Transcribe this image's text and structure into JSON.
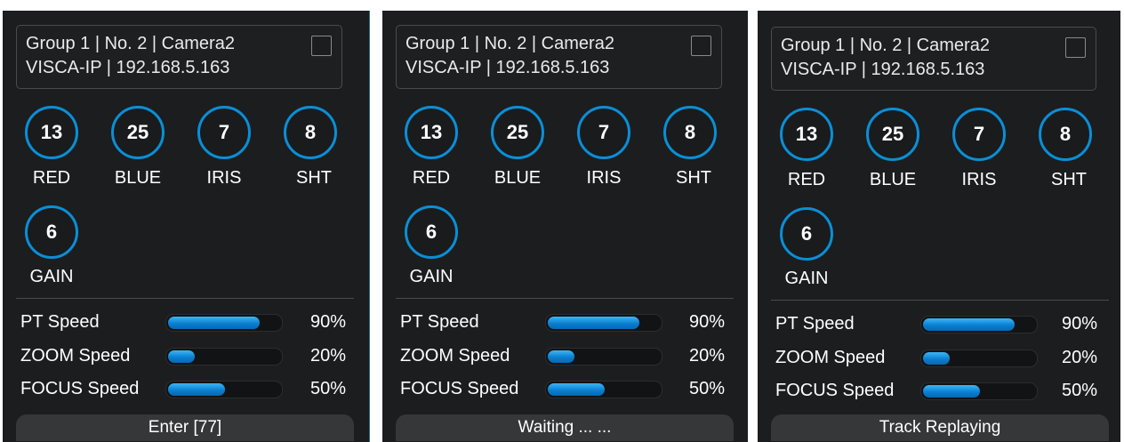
{
  "panels": [
    {
      "info": {
        "line1": "Group 1 | No. 2 | Camera2",
        "line2": "VISCA-IP | 192.168.5.163"
      },
      "knobs": [
        {
          "value": "13",
          "label": "RED"
        },
        {
          "value": "25",
          "label": "BLUE"
        },
        {
          "value": "7",
          "label": "IRIS"
        },
        {
          "value": "8",
          "label": "SHT"
        },
        {
          "value": "6",
          "label": "GAIN"
        }
      ],
      "speeds": [
        {
          "label": "PT Speed",
          "percent_text": "90%",
          "fill_fraction": 0.82
        },
        {
          "label": "ZOOM Speed",
          "percent_text": "20%",
          "fill_fraction": 0.24
        },
        {
          "label": "FOCUS Speed",
          "percent_text": "50%",
          "fill_fraction": 0.51
        }
      ],
      "status": "Enter [77]"
    },
    {
      "info": {
        "line1": "Group 1 | No. 2 | Camera2",
        "line2": "VISCA-IP | 192.168.5.163"
      },
      "knobs": [
        {
          "value": "13",
          "label": "RED"
        },
        {
          "value": "25",
          "label": "BLUE"
        },
        {
          "value": "7",
          "label": "IRIS"
        },
        {
          "value": "8",
          "label": "SHT"
        },
        {
          "value": "6",
          "label": "GAIN"
        }
      ],
      "speeds": [
        {
          "label": "PT Speed",
          "percent_text": "90%",
          "fill_fraction": 0.82
        },
        {
          "label": "ZOOM Speed",
          "percent_text": "20%",
          "fill_fraction": 0.24
        },
        {
          "label": "FOCUS Speed",
          "percent_text": "50%",
          "fill_fraction": 0.51
        }
      ],
      "status": "Waiting ... ..."
    },
    {
      "info": {
        "line1": "Group 1 | No. 2 | Camera2",
        "line2": "VISCA-IP | 192.168.5.163"
      },
      "knobs": [
        {
          "value": "13",
          "label": "RED"
        },
        {
          "value": "25",
          "label": "BLUE"
        },
        {
          "value": "7",
          "label": "IRIS"
        },
        {
          "value": "8",
          "label": "SHT"
        },
        {
          "value": "6",
          "label": "GAIN"
        }
      ],
      "speeds": [
        {
          "label": "PT Speed",
          "percent_text": "90%",
          "fill_fraction": 0.82
        },
        {
          "label": "ZOOM Speed",
          "percent_text": "20%",
          "fill_fraction": 0.24
        },
        {
          "label": "FOCUS Speed",
          "percent_text": "50%",
          "fill_fraction": 0.51
        }
      ],
      "status": "Track Replaying"
    }
  ],
  "colors": {
    "panel_bg": "#1c1d1f",
    "knob_ring": "#0a8fd7",
    "bar_fill": "#0a7fd1",
    "status_bg": "#363739"
  }
}
